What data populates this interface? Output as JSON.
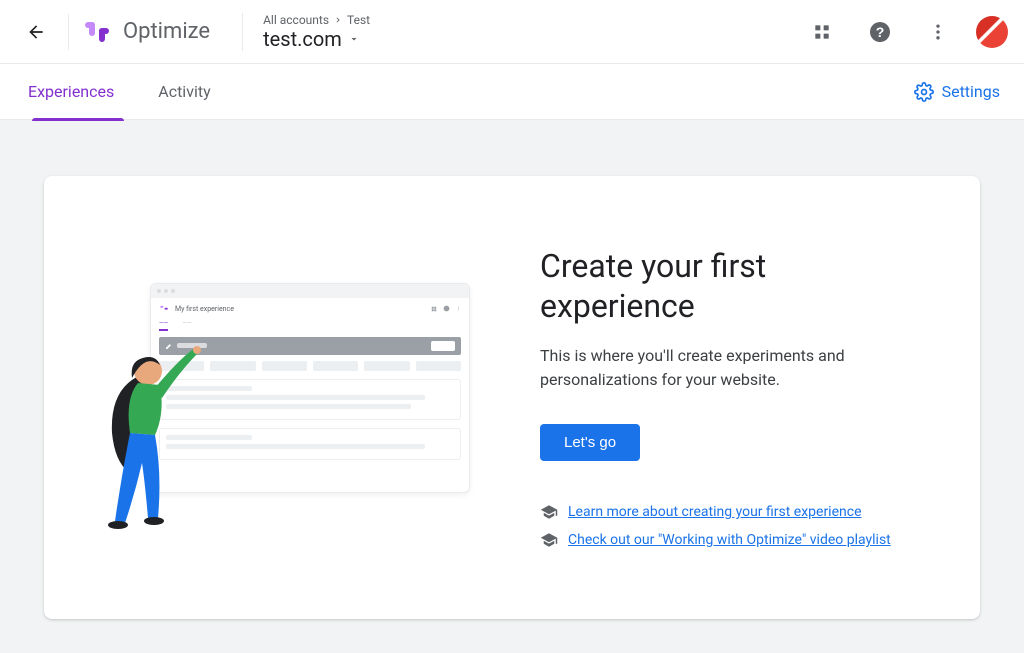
{
  "header": {
    "product_name": "Optimize",
    "breadcrumb_parent": "All accounts",
    "breadcrumb_child": "Test",
    "account_domain": "test.com"
  },
  "tabs": {
    "experiences": "Experiences",
    "activity": "Activity",
    "settings": "Settings"
  },
  "illustration": {
    "mock_title": "My first experience"
  },
  "main": {
    "title": "Create your first experience",
    "subtitle": "This is where you'll create experiments and personalizations for your website.",
    "cta_label": "Let's go",
    "link1": "Learn more about creating your first experience",
    "link2": "Check out our \"Working with Optimize\" video playlist"
  }
}
